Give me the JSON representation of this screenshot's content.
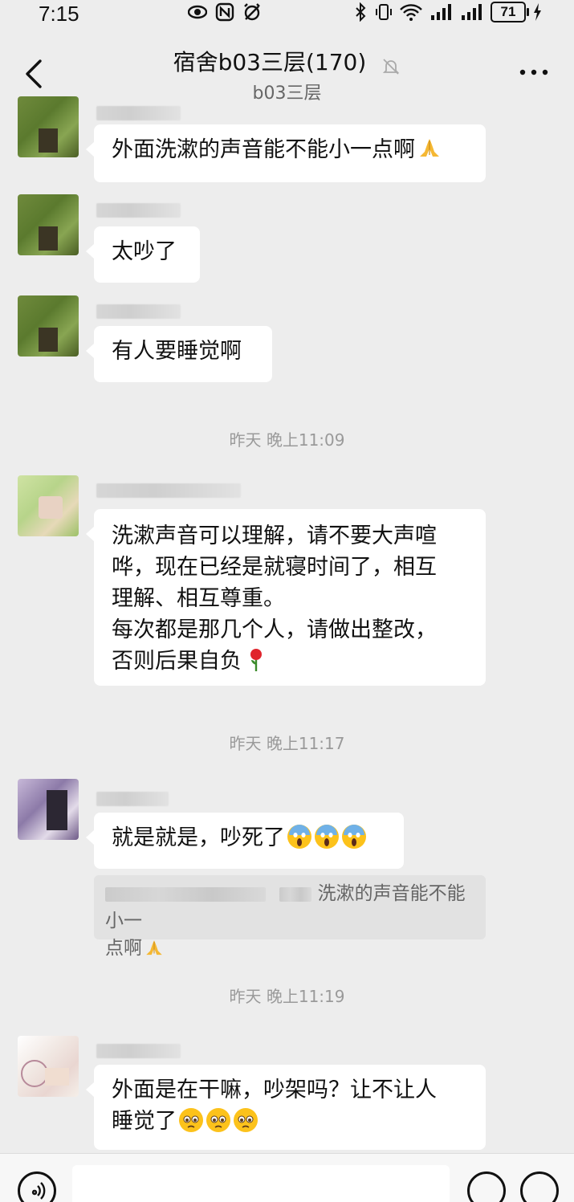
{
  "status": {
    "time": "7:15",
    "battery": "71"
  },
  "header": {
    "title": "宿舍b03三层(170)",
    "subtitle": "b03三层"
  },
  "messages": [
    {
      "text_lines": [
        "外面洗漱的声音能不能小一点啊"
      ],
      "emoji": [
        "pray"
      ]
    },
    {
      "text_lines": [
        "太吵了"
      ],
      "emoji": []
    },
    {
      "text_lines": [
        "有人要睡觉啊"
      ],
      "emoji": []
    },
    {
      "text_lines": [
        "洗漱声音可以理解，请不要大声喧",
        "哗，现在已经是就寝时间了，相互",
        "理解、相互尊重。",
        "每次都是那几个人，请做出整改，",
        "否则后果自负"
      ],
      "emoji": [
        "rose"
      ]
    },
    {
      "text_lines": [
        "就是就是，吵死了"
      ],
      "emoji": [
        "scream",
        "scream",
        "scream"
      ]
    },
    {
      "text_lines": [
        "外面是在干嘛，吵架吗？让不让人",
        "睡觉了"
      ],
      "emoji": [
        "pleading",
        "pleading",
        "pleading"
      ]
    }
  ],
  "quote": {
    "visible_text_line1": "洗漱的声音能不能小一",
    "visible_text_line2": "点啊",
    "emoji": "pray"
  },
  "timestamps": [
    "昨天 晚上11:09",
    "昨天 晚上11:17",
    "昨天 晚上11:19"
  ],
  "icons": {
    "back": "chevron-left-icon",
    "mute": "bell-off-icon",
    "more": "more-dots-icon",
    "voice": "voice-icon",
    "emoji": "emoji-icon",
    "plus": "plus-icon"
  },
  "colors": {
    "background": "#ededed",
    "bubble": "#ffffff",
    "timestamp": "#9a9a9a"
  }
}
